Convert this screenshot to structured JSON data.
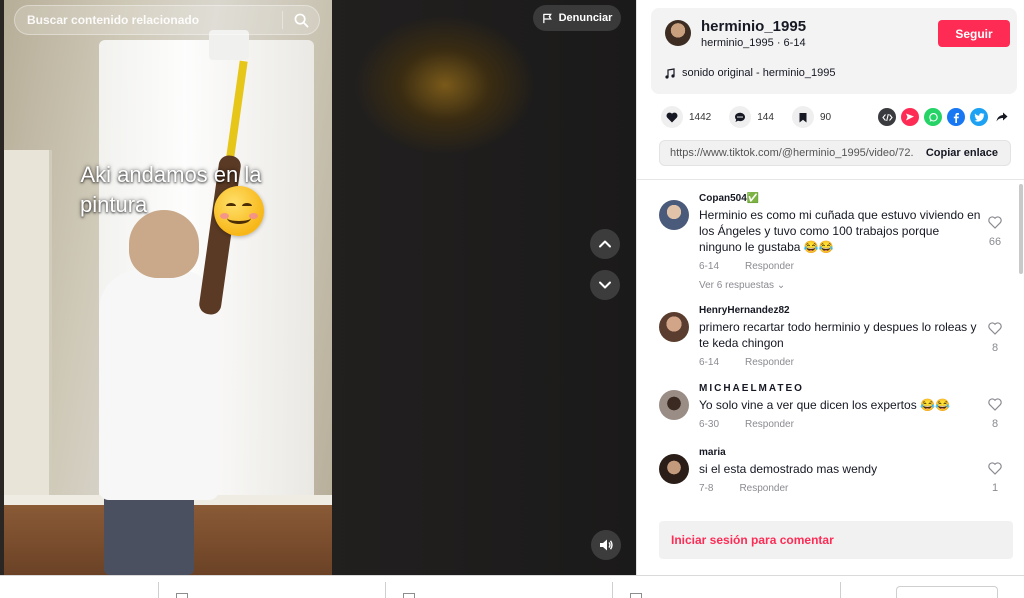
{
  "search": {
    "placeholder": "Buscar contenido relacionado"
  },
  "video": {
    "caption_line1": "Aki  andamos en la",
    "caption_line2": "pintura",
    "report_label": "Denunciar"
  },
  "author": {
    "username": "herminio_1995",
    "subline": "herminio_1995 · 6-14",
    "follow_label": "Seguir",
    "sound": "sonido original - herminio_1995"
  },
  "stats": {
    "likes": "1442",
    "comments": "144",
    "saves": "90"
  },
  "share": {
    "icons": [
      "embed-icon",
      "send-icon",
      "whatsapp-icon",
      "facebook-icon",
      "twitter-icon",
      "share-arrow-icon"
    ],
    "colors": {
      "embed": "#3a3b3f",
      "send": "#fe2c55",
      "whatsapp": "#25d366",
      "facebook": "#1877f2",
      "twitter": "#1da1f2"
    }
  },
  "link": {
    "url": "https://www.tiktok.com/@herminio_1995/video/72...",
    "copy_label": "Copiar enlace"
  },
  "comments": [
    {
      "user": "Copan504✅",
      "text": "Herminio es como mi cuñada que estuvo viviendo en los Ángeles y tuvo como 100 trabajos porque ninguno le gustaba 😂😂",
      "date": "6-14",
      "reply": "Responder",
      "likes": "66",
      "more": "Ver 6 respuestas ⌄"
    },
    {
      "user": "HenryHernandez82",
      "text": "primero recartar todo herminio y despues lo roleas y te keda chingon",
      "date": "6-14",
      "reply": "Responder",
      "likes": "8"
    },
    {
      "user": "MICHAELMATEO",
      "text": "Yo solo vine a ver que dicen los expertos 😂😂",
      "date": "6-30",
      "reply": "Responder",
      "likes": "8"
    },
    {
      "user": "maria",
      "text": "si el esta demostrado mas wendy",
      "date": "7-8",
      "reply": "Responder",
      "likes": "1"
    }
  ],
  "login_prompt": "Iniciar sesión para comentar",
  "colors": {
    "accent": "#fe2c55",
    "text": "#161823",
    "muted": "#8a8b91"
  }
}
